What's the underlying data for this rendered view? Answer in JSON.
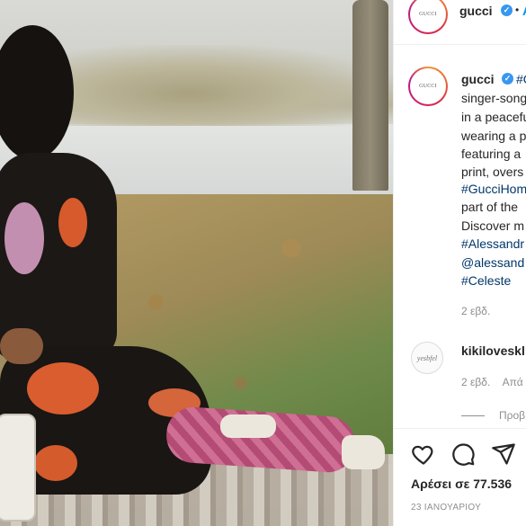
{
  "post": {
    "username": "gucci",
    "avatar_text": "GUCCI",
    "follow_dot": "•",
    "follow_label": "Ακ"
  },
  "caption": {
    "username": "gucci",
    "first_tail": "#G",
    "lines": [
      {
        "text": "singer-song",
        "tag": false
      },
      {
        "text": "in a peacefu",
        "tag": false
      },
      {
        "text": "wearing a p",
        "tag": false
      },
      {
        "text": "featuring a",
        "tag": false
      },
      {
        "text": "print, overs",
        "tag": false
      },
      {
        "text": "#GucciHom",
        "tag": true
      },
      {
        "text": "part of the",
        "tag": false
      },
      {
        "text": "Discover m",
        "tag": false
      },
      {
        "text": "#Alessandr",
        "tag": true
      },
      {
        "text": "@alessand",
        "tag": true
      },
      {
        "text": "#Celeste",
        "tag": true
      }
    ],
    "time": "2 εβδ."
  },
  "comment": {
    "avatar_text": "yesbfel",
    "username": "kikiloveskl",
    "time": "2 εβδ.",
    "reply_label": "Απά"
  },
  "view_replies": "Προβ",
  "actions": {
    "icons": [
      "heart-icon",
      "comment-icon",
      "share-icon"
    ]
  },
  "likes_text": "Αρέσει σε 77.536",
  "date_text": "23 ΙΑΝΟΥΑΡΙΟΥ",
  "colors": {
    "accent": "#3897f0",
    "hashtag": "#00376b",
    "muted": "#8e8e8e",
    "text": "#262626"
  }
}
